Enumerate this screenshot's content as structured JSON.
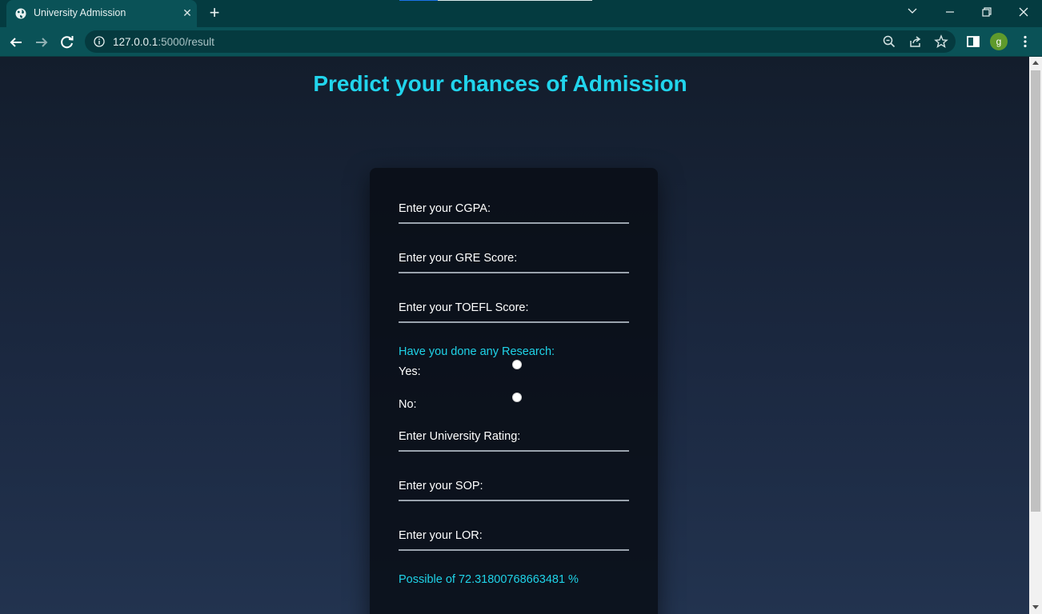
{
  "browser": {
    "tab_title": "University Admission",
    "tab_close": "✕",
    "new_tab": "+",
    "url_host": "127.0.0.1",
    "url_rest": ":5000/result",
    "profile_initial": "g"
  },
  "page": {
    "title": "Predict your chances of Admission"
  },
  "form": {
    "cgpa_label": "Enter your CGPA:",
    "gre_label": "Enter your GRE Score:",
    "toefl_label": "Enter your TOEFL Score:",
    "research_label": "Have you done any Research:",
    "yes_label": "Yes:",
    "no_label": "No:",
    "rating_label": "Enter University Rating:",
    "sop_label": "Enter your SOP:",
    "lor_label": "Enter your LOR:",
    "result": "Possible of 72.31800768663481 %"
  },
  "colors": {
    "accent": "#21d4ec",
    "chrome": "#0a5257"
  }
}
